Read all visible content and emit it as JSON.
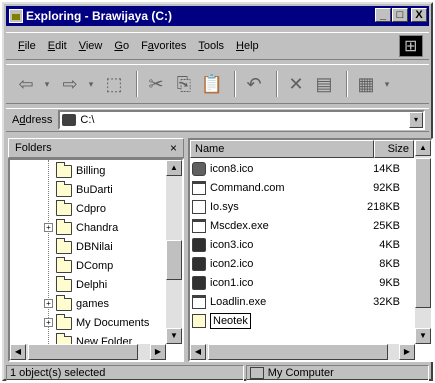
{
  "window": {
    "title": "Exploring - Brawijaya (C:)",
    "minimize": "_",
    "maximize": "□",
    "close": "X"
  },
  "menu": [
    {
      "label": "File",
      "accel": "F",
      "rest": "ile"
    },
    {
      "label": "Edit",
      "accel": "E",
      "rest": "dit"
    },
    {
      "label": "View",
      "accel": "V",
      "rest": "iew"
    },
    {
      "label": "Go",
      "accel": "G",
      "rest": "o"
    },
    {
      "label": "Favorites",
      "accel": "a",
      "pre": "F",
      "rest": "vorites"
    },
    {
      "label": "Tools",
      "accel": "T",
      "rest": "ools"
    },
    {
      "label": "Help",
      "accel": "H",
      "rest": "elp"
    }
  ],
  "toolbar": {
    "back": "⇦",
    "forward": "⇨",
    "up": "⬚",
    "cut": "✂",
    "copy": "⎘",
    "paste": "📋",
    "undo": "↶",
    "delete": "✕",
    "properties": "▤",
    "views": "▦",
    "dropdown": "▾"
  },
  "address": {
    "label_accel": "d",
    "label_pre": "A",
    "label_rest": "dress",
    "value": "C:\\",
    "dropdown": "▾"
  },
  "folders_pane": {
    "title": "Folders",
    "close": "×",
    "items": [
      {
        "label": "Billing",
        "expandable": false
      },
      {
        "label": "BuDarti",
        "expandable": false
      },
      {
        "label": "Cdpro",
        "expandable": false
      },
      {
        "label": "Chandra",
        "expandable": true
      },
      {
        "label": "DBNilai",
        "expandable": false
      },
      {
        "label": "DComp",
        "expandable": false
      },
      {
        "label": "Delphi",
        "expandable": false
      },
      {
        "label": "games",
        "expandable": true
      },
      {
        "label": "My Documents",
        "expandable": true
      },
      {
        "label": "New Folder",
        "expandable": false
      }
    ]
  },
  "files_pane": {
    "columns": {
      "name": "Name",
      "size": "Size"
    },
    "files": [
      {
        "name": "icon8.ico",
        "size": "14KB",
        "kind": "ico"
      },
      {
        "name": "Command.com",
        "size": "92KB",
        "kind": "exe"
      },
      {
        "name": "Io.sys",
        "size": "218KB",
        "kind": "sys"
      },
      {
        "name": "Mscdex.exe",
        "size": "25KB",
        "kind": "exe"
      },
      {
        "name": "icon3.ico",
        "size": "4KB",
        "kind": "ico2"
      },
      {
        "name": "icon2.ico",
        "size": "8KB",
        "kind": "ico2"
      },
      {
        "name": "icon1.ico",
        "size": "9KB",
        "kind": "ico2"
      },
      {
        "name": "Loadlin.exe",
        "size": "32KB",
        "kind": "exe"
      },
      {
        "name": "Neotek",
        "size": "",
        "kind": "folder",
        "renaming": true
      }
    ]
  },
  "status": {
    "selection": "1 object(s) selected",
    "location": "My Computer"
  }
}
